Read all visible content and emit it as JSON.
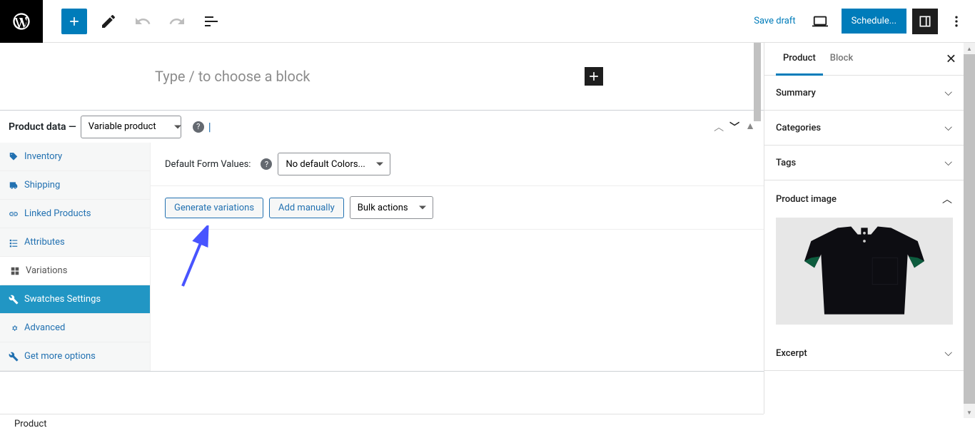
{
  "topbar": {
    "save_draft": "Save draft",
    "schedule": "Schedule..."
  },
  "editor": {
    "block_prompt": "Type / to choose a block"
  },
  "product_data": {
    "header_label": "Product data —",
    "type_options": [
      "Variable product"
    ],
    "selected_type": "Variable product",
    "tabs": [
      {
        "id": "inventory",
        "label": "Inventory",
        "icon": "tag"
      },
      {
        "id": "shipping",
        "label": "Shipping",
        "icon": "truck"
      },
      {
        "id": "linked",
        "label": "Linked Products",
        "icon": "link"
      },
      {
        "id": "attributes",
        "label": "Attributes",
        "icon": "list"
      },
      {
        "id": "variations",
        "label": "Variations",
        "icon": "grid",
        "active": true
      },
      {
        "id": "swatches",
        "label": "Swatches Settings",
        "icon": "wrench",
        "selected": true
      },
      {
        "id": "advanced",
        "label": "Advanced",
        "icon": "gear"
      },
      {
        "id": "more",
        "label": "Get more options",
        "icon": "wrench"
      }
    ],
    "default_form_label": "Default Form Values:",
    "default_form_value": "No default Colors...",
    "generate_btn": "Generate variations",
    "add_manually_btn": "Add manually",
    "bulk_actions": "Bulk actions"
  },
  "sidebar": {
    "tabs": {
      "product": "Product",
      "block": "Block"
    },
    "panels": {
      "summary": "Summary",
      "categories": "Categories",
      "tags": "Tags",
      "product_image": "Product image",
      "excerpt": "Excerpt"
    }
  },
  "footer": {
    "breadcrumb": "Product"
  }
}
